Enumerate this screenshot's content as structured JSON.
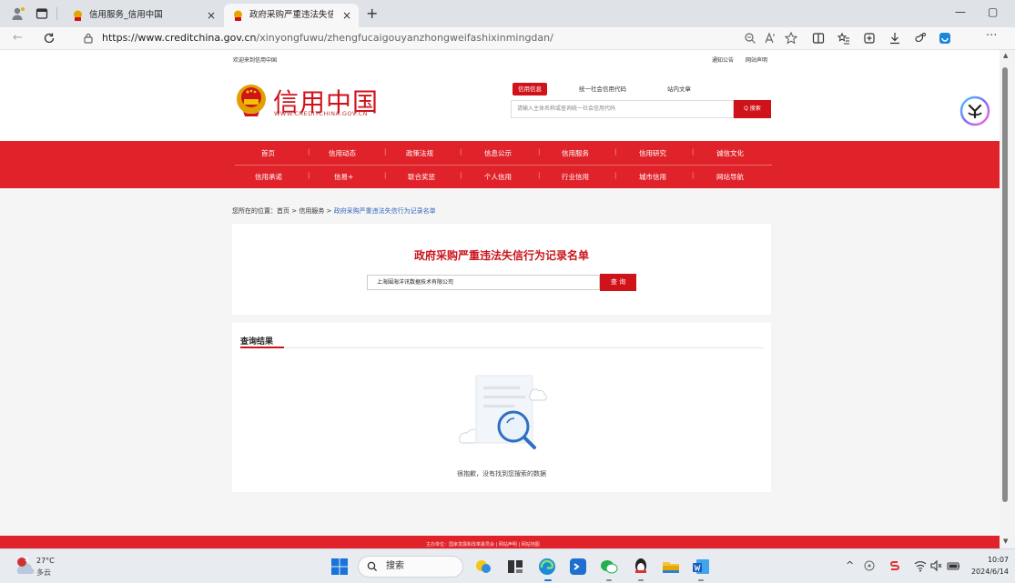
{
  "browser": {
    "tabs": [
      {
        "title": "信用服务_信用中国",
        "active": false
      },
      {
        "title": "政府采购严重违法失信行为记录",
        "active": true
      }
    ],
    "close_glyph": "×",
    "newtab_glyph": "+",
    "url_host": "https://www.creditchina.gov.cn",
    "url_path": "/xinyongfuwu/zhengfucaigouyanzhongweifashixinmingdan/",
    "icons": [
      "profile-icon",
      "tab-actions-icon",
      "back-icon",
      "refresh-icon",
      "site-info-icon",
      "zoom-icon",
      "read-aloud-icon",
      "favorite-icon",
      "split-screen-icon",
      "favorites-icon",
      "collections-icon",
      "download-icon",
      "extensions-icon",
      "office-icon",
      "more-icon",
      "minimize-icon",
      "restore-icon"
    ]
  },
  "site": {
    "welcome": "欢迎来到信用中国",
    "top_links": [
      "通知公告",
      "网站声明"
    ],
    "logo_title": "信用中国",
    "logo_sub": "WWW.CREDITCHINA.GOV.CN",
    "search_tabs": [
      "信用信息",
      "统一社会信用代码",
      "站内文章"
    ],
    "search_placeholder": "请输入主体名称或查询统一社会信用代码",
    "search_button": "Q 搜索",
    "nav_row1": [
      "首页",
      "信用动态",
      "政策法规",
      "信息公示",
      "信用服务",
      "信用研究",
      "诚信文化"
    ],
    "nav_row2": [
      "信用承诺",
      "信易+",
      "联合奖惩",
      "个人信用",
      "行业信用",
      "城市信用",
      "网站导航"
    ],
    "breadcrumb": {
      "prefix": "您所在的位置：首页 > 信用服务 > ",
      "current": "政府采购严重违法失信行为记录名单"
    },
    "query": {
      "title": "政府采购严重违法失信行为记录名单",
      "input_value": "上海围海洋讯数据技术有限公司",
      "button": "查 询"
    },
    "results": {
      "title": "查询结果",
      "empty_text": "很抱歉，没有找到您搜索的数据"
    },
    "footer_text": "主办单位：国家发展和改革委员会 | 网站声明 | 网站地图"
  },
  "taskbar": {
    "weather_badge": "1",
    "temperature": "27°C",
    "weather_desc": "多云",
    "search_label": "搜索",
    "time": "10:07",
    "date": "2024/6/14",
    "tray_icons": [
      "chevron-up-icon",
      "network-icon",
      "ime-icon",
      "wifi-icon",
      "volume-icon",
      "battery-icon"
    ]
  },
  "colors": {
    "brand_red": "#d0121b",
    "nav_red": "#e0232a",
    "link_blue": "#3366bb"
  }
}
